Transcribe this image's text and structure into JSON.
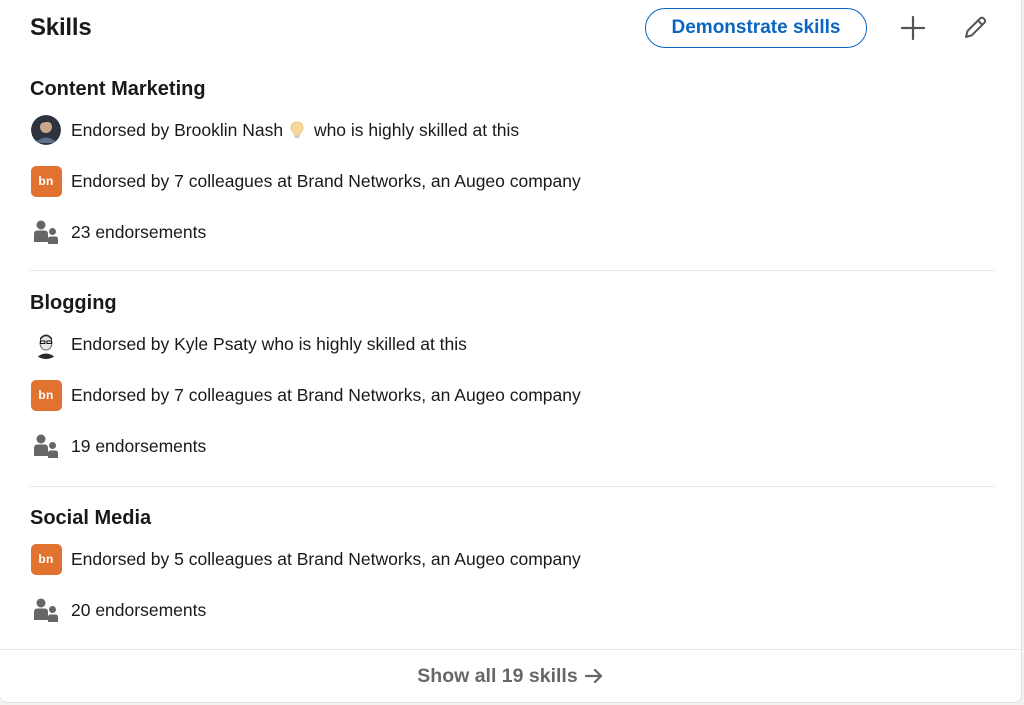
{
  "section": {
    "title": "Skills",
    "demonstrate_label": "Demonstrate skills",
    "add_icon": "plus-icon",
    "edit_icon": "pencil-icon"
  },
  "skills": [
    {
      "name": "Content Marketing",
      "endorser": {
        "prefix": "Endorsed by ",
        "name": "Brooklin Nash",
        "badge_icon": "lightbulb-icon",
        "suffix": " who is highly skilled at this"
      },
      "company_text": "Endorsed by 7 colleagues at Brand Networks, an Augeo company",
      "company_logo": "bn",
      "count_text": "23 endorsements"
    },
    {
      "name": "Blogging",
      "endorser": {
        "prefix": "Endorsed by ",
        "name": "Kyle Psaty",
        "suffix": " who is highly skilled at this"
      },
      "company_text": "Endorsed by 7 colleagues at Brand Networks, an Augeo company",
      "company_logo": "bn",
      "count_text": "19 endorsements"
    },
    {
      "name": "Social Media",
      "company_text": "Endorsed by 5 colleagues at Brand Networks, an Augeo company",
      "company_logo": "bn",
      "count_text": "20 endorsements"
    }
  ],
  "footer": {
    "label": "Show all 19 skills",
    "arrow_icon": "arrow-right-icon"
  },
  "colors": {
    "accent": "#0a66c2",
    "logo": "#e2722f",
    "icon_gray": "#666666"
  }
}
